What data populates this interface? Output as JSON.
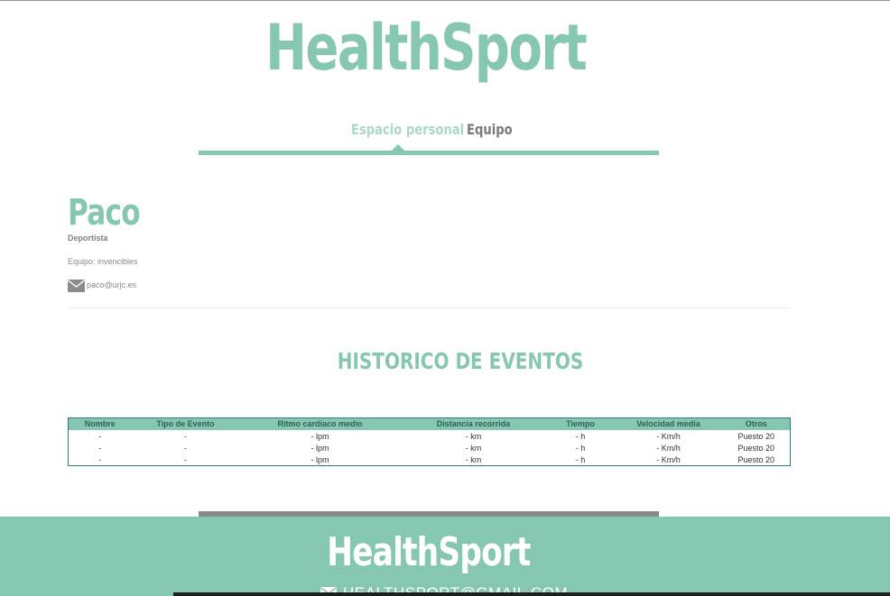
{
  "brand": {
    "title": "HealthSport"
  },
  "nav": {
    "tabs": [
      {
        "label": "Espacio personal"
      },
      {
        "label": "Equipo"
      }
    ]
  },
  "profile": {
    "name": "Paco",
    "role": "Deportista",
    "team": "Equipo: invencibles",
    "email": "paco@urjc.es",
    "email_icon": "envelope-icon"
  },
  "history": {
    "title": "HISTORICO DE EVENTOS",
    "columns": [
      "Nombre",
      "Tipo de Evento",
      "Ritmo cardiaco medio",
      "Distancia recorrida",
      "Tiempo",
      "Velocidad media",
      "Otros"
    ],
    "rows": [
      [
        "-",
        "-",
        "- lpm",
        "- km",
        "- h",
        "- Km/h",
        "Puesto 20"
      ],
      [
        "-",
        "-",
        "- lpm",
        "- km",
        "- h",
        "- Km/h",
        "Puesto 20"
      ],
      [
        "-",
        "-",
        "- lpm",
        "- km",
        "- h",
        "- Km/h",
        "Puesto 20"
      ]
    ]
  },
  "footer": {
    "title": "HealthSport",
    "email": "HEALTHSPORT@GMAIL.COM",
    "email_icon": "envelope-icon"
  },
  "colors": {
    "accent": "#86c7b1",
    "accent_light": "#a9d9c7",
    "table_border": "#2f7787",
    "divider_bar": "#8a8a8a"
  }
}
